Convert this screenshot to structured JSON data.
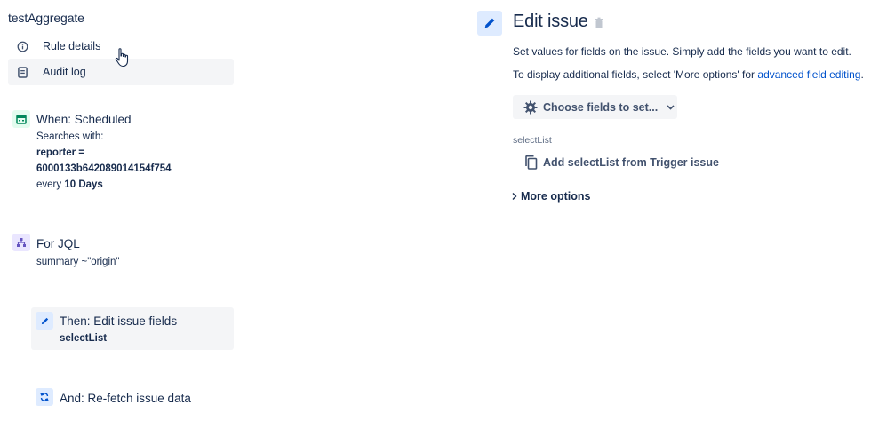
{
  "rule": {
    "title": "testAggregate",
    "nav": [
      {
        "label": "Rule details",
        "icon": "info-icon"
      },
      {
        "label": "Audit log",
        "icon": "document-icon"
      }
    ]
  },
  "steps": {
    "trigger": {
      "title": "When: Scheduled",
      "line1": "Searches with:",
      "line2": "reporter =",
      "line3": "6000133b642089014154f754",
      "line4_prefix": "every ",
      "line4_value": "10 Days",
      "icon": "calendar-icon",
      "color": "#00875a"
    },
    "branch": {
      "title": "For JQL",
      "sub": "summary ~\"origin\"",
      "icon": "hierarchy-icon",
      "color": "#6554c0"
    },
    "action_edit": {
      "title": "Then: Edit issue fields",
      "sub": "selectList",
      "icon": "pencil-icon",
      "color": "#0052cc"
    },
    "action_refetch": {
      "title": "And: Re-fetch issue data",
      "icon": "refresh-icon",
      "color": "#0052cc"
    }
  },
  "editor": {
    "title": "Edit issue",
    "description1": "Set values for fields on the issue. Simply add the fields you want to edit.",
    "description2_prefix": "To display additional fields, select 'More options' for ",
    "description2_link": "advanced field editing",
    "description2_suffix": ".",
    "choose_fields_label": "Choose fields to set...",
    "field_label": "selectList",
    "add_field_label": "Add selectList from Trigger issue",
    "more_options_label": "More options"
  }
}
